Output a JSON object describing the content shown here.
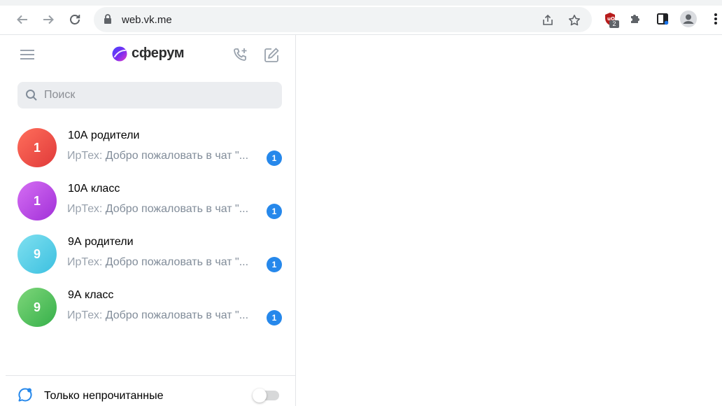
{
  "browser": {
    "url": "web.vk.me",
    "extension_badge": "2"
  },
  "app": {
    "logo_text": "сферум",
    "accent_color": "#2688eb"
  },
  "search": {
    "placeholder": "Поиск"
  },
  "chats": [
    {
      "title": "10А родители",
      "avatar_text": "1",
      "avatar_color": "#e64646",
      "author": "ИрТех:",
      "message": "Добро пожаловать в чат \"...",
      "unread": "1"
    },
    {
      "title": "10А класс",
      "avatar_text": "1",
      "avatar_color": "#bb43e0",
      "author": "ИрТех:",
      "message": "Добро пожаловать в чат \"...",
      "unread": "1"
    },
    {
      "title": "9А родители",
      "avatar_text": "9",
      "avatar_color": "#4bcfe6",
      "author": "ИрТех:",
      "message": "Добро пожаловать в чат \"...",
      "unread": "1"
    },
    {
      "title": "9А класс",
      "avatar_text": "9",
      "avatar_color": "#4bbe54",
      "author": "ИрТех:",
      "message": "Добро пожаловать в чат \"...",
      "unread": "1"
    }
  ],
  "footer": {
    "unread_only_label": "Только непрочитанные",
    "unread_only_enabled": false
  }
}
